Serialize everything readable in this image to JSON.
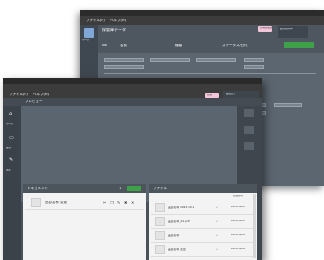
{
  "back_window": {
    "menu": [
      "ファイル(F)",
      "ヘルプ(H)"
    ],
    "nav_home_label": "ホーム",
    "form_title": "保管庫データ",
    "columns": [
      "No",
      "名前",
      "種類",
      "ステータス/日付"
    ],
    "badge": "担当者確認",
    "status_label": "読み込み中",
    "tabs": [
      "検索結果",
      "プレビュー"
    ]
  },
  "front_window": {
    "menu": [
      "ファイル(F)",
      "ヘルプ(H)"
    ],
    "badge": "新規",
    "status_label": "読込完了",
    "nav": [
      {
        "icon": "home-icon",
        "label": "ホーム"
      },
      {
        "icon": "folder-icon",
        "label": "保存"
      },
      {
        "icon": "wrench-icon",
        "label": "設定"
      }
    ],
    "viewer_label": "プレビュー",
    "left_panel": {
      "title": "ドキュメント",
      "counter": "1",
      "item_label": "品目名称 変更",
      "tools": [
        "✂",
        "❐",
        "✎",
        "✖",
        "✕"
      ]
    },
    "right_panel": {
      "title": "ファイル",
      "header_col": "登録日時",
      "rows": [
        {
          "name": "品目名称 2023.10.1",
          "flag": "✓",
          "date": "2023/10/05"
        },
        {
          "name": "品目名称_01.pdf",
          "flag": "✓",
          "date": "2023/10/05"
        },
        {
          "name": "品目名称",
          "flag": "✓",
          "date": "2023/10/04"
        },
        {
          "name": "品目名称 変更",
          "flag": "✓",
          "date": "2023/10/04"
        }
      ]
    }
  },
  "colors": {
    "back_dark": "#4e5760",
    "front_dark": "#4a5158",
    "accent_pink": "#f2c6d8",
    "accent_green": "#3fa04a"
  }
}
